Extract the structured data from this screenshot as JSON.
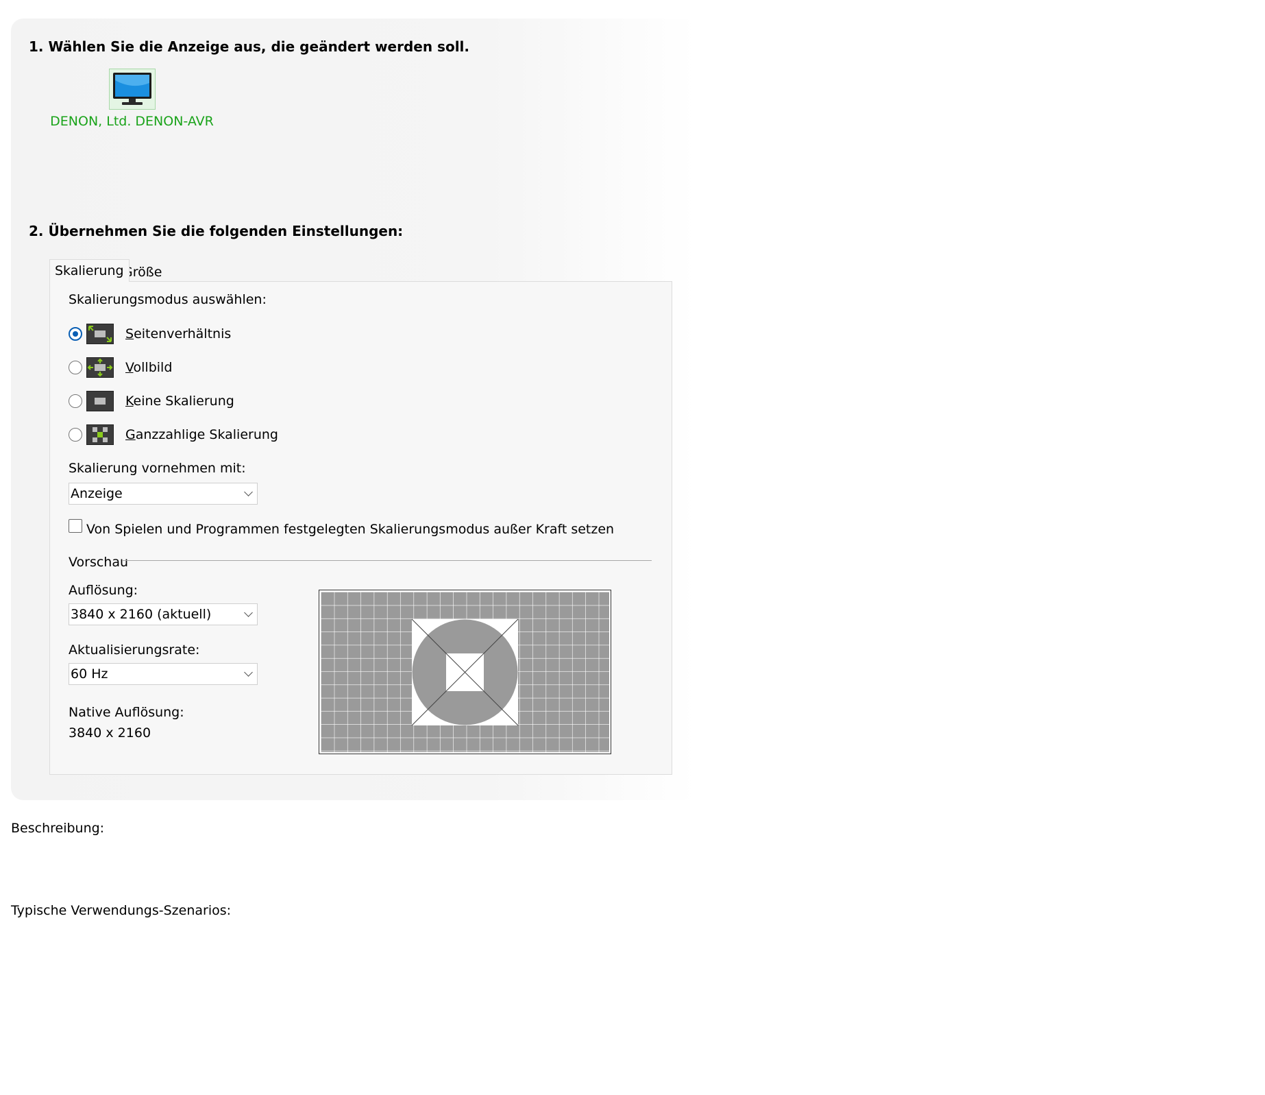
{
  "step1": {
    "title": "1. Wählen Sie die Anzeige aus, die geändert werden soll."
  },
  "display": {
    "name": "DENON, Ltd. DENON-AVR",
    "icon": "monitor-icon"
  },
  "step2": {
    "title": "2. Übernehmen Sie die folgenden Einstellungen:"
  },
  "tabs": [
    {
      "label": "Skalierung",
      "active": true
    },
    {
      "label": "Größe",
      "active": false
    }
  ],
  "scaling": {
    "mode_label": "Skalierungsmodus auswählen:",
    "modes": [
      {
        "first": "S",
        "rest": "eitenverhältnis",
        "selected": true
      },
      {
        "first": "V",
        "rest": "ollbild",
        "selected": false
      },
      {
        "first": "K",
        "rest": "eine Skalierung",
        "selected": false
      },
      {
        "first": "G",
        "rest": "anzzahlige Skalierung",
        "selected": false
      }
    ],
    "perform_label": "Skalierung vornehmen mit:",
    "perform_value": "Anzeige",
    "override_label": "Von Spielen und Programmen festgelegten Skalierungsmodus außer Kraft setzen",
    "override_checked": false
  },
  "preview": {
    "label": "Vorschau",
    "resolution_label": "Auflösung:",
    "resolution_value": "3840 x 2160 (aktuell)",
    "refresh_label": "Aktualisierungsrate:",
    "refresh_value": "60 Hz",
    "native_label": "Native Auflösung:",
    "native_value": "3840 x 2160"
  },
  "description_label": "Beschreibung:",
  "scenarios_label": "Typische Verwendungs-Szenarios:",
  "colors": {
    "accent": "#0a5fb4",
    "display_label": "#1aa31a",
    "mode_arrow": "#8acb1c"
  }
}
